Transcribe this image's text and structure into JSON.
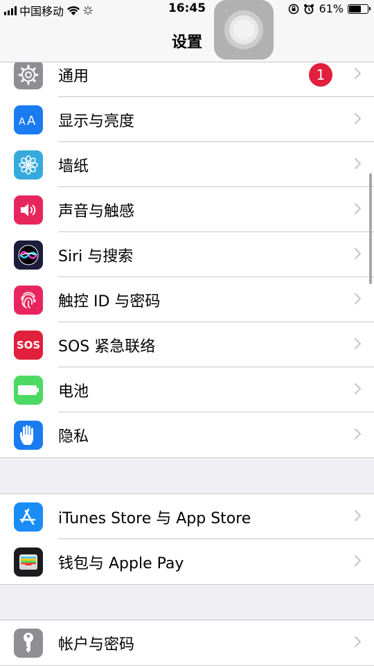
{
  "status": {
    "carrier": "中国移动",
    "time": "16:45",
    "battery_pct": "61%",
    "battery_level": 0.61
  },
  "nav": {
    "title": "设置"
  },
  "groups": [
    {
      "items": [
        {
          "label": "通用",
          "icon": "gear-icon",
          "color": "#8e8e93",
          "badge": "1"
        },
        {
          "label": "显示与亮度",
          "icon": "aa-icon",
          "color": "#1a7cf0"
        },
        {
          "label": "墙纸",
          "icon": "flower-icon",
          "color": "#36aadc"
        },
        {
          "label": "声音与触感",
          "icon": "speaker-icon",
          "color": "#e8265e"
        },
        {
          "label": "Siri 与搜索",
          "icon": "siri-icon",
          "color": "#1c1c3c"
        },
        {
          "label": "触控 ID 与密码",
          "icon": "fingerprint-icon",
          "color": "#e8265e"
        },
        {
          "label": "SOS 紧急联络",
          "icon": "sos-icon",
          "color": "#e0203c",
          "icon_text": "SOS"
        },
        {
          "label": "电池",
          "icon": "battery-icon",
          "color": "#4cd964"
        },
        {
          "label": "隐私",
          "icon": "hand-icon",
          "color": "#1a7cf0"
        }
      ]
    },
    {
      "items": [
        {
          "label": "iTunes Store 与 App Store",
          "icon": "app-store-icon",
          "color": "#1a8cf5"
        },
        {
          "label": "钱包与 Apple Pay",
          "icon": "wallet-icon",
          "color": "#1c1c1e"
        }
      ]
    },
    {
      "items": [
        {
          "label": "帐户与密码",
          "icon": "key-icon",
          "color": "#8e8e93"
        }
      ]
    }
  ]
}
